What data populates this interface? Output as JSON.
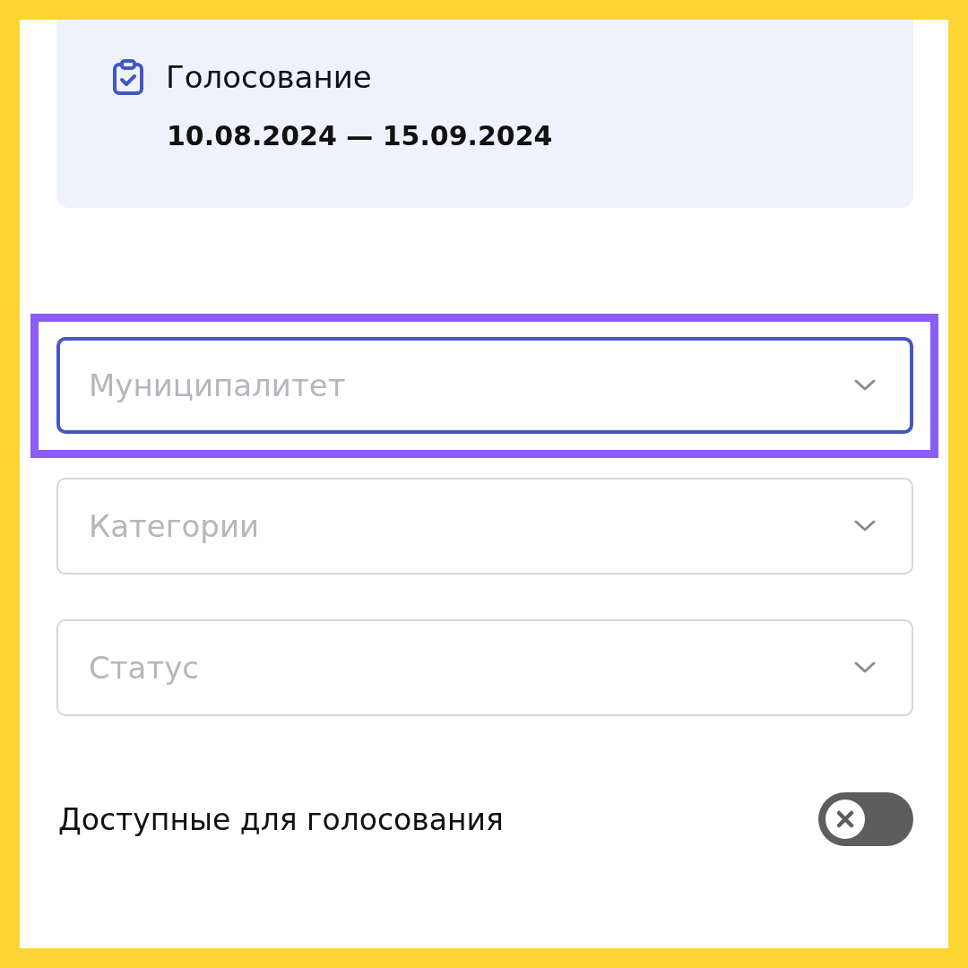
{
  "voting_card": {
    "title": "Голосование",
    "dates": "10.08.2024 — 15.09.2024"
  },
  "filters": [
    {
      "placeholder": "Муниципалитет",
      "focused": true,
      "highlighted": true
    },
    {
      "placeholder": "Категории",
      "focused": false,
      "highlighted": false
    },
    {
      "placeholder": "Статус",
      "focused": false,
      "highlighted": false
    }
  ],
  "toggle": {
    "label": "Доступные для голосования",
    "on": false
  }
}
